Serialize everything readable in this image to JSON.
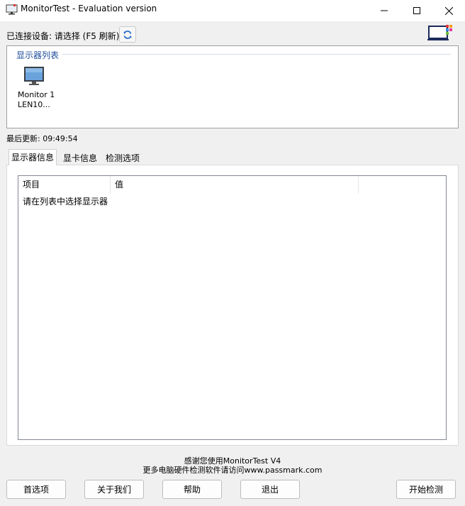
{
  "window": {
    "title": "MonitorTest - Evaluation version",
    "controls": [
      "minimize",
      "maximize",
      "close"
    ]
  },
  "device": {
    "label": "已连接设备: 请选择 (F5 刷新)",
    "refresh_icon": "refresh-icon"
  },
  "monitor_list": {
    "title": "显示器列表",
    "items": [
      {
        "name": "Monitor 1",
        "sub": "LEN10...",
        "icon": "monitor-icon"
      }
    ]
  },
  "last_update": "最后更新: 09:49:54",
  "tabs": [
    {
      "label": "显示器信息",
      "active": true
    },
    {
      "label": "显卡信息",
      "active": false
    },
    {
      "label": "检测选项",
      "active": false
    }
  ],
  "table": {
    "columns": [
      "项目",
      "值"
    ],
    "rows": [
      [
        "请在列表中选择显示器",
        ""
      ]
    ]
  },
  "footer": {
    "line1": "感谢您使用MonitorTest V4",
    "line2": "更多电脑硬件检测软件请访问www.passmark.com"
  },
  "buttons": {
    "preferences": "首选项",
    "about": "关于我们",
    "help": "帮助",
    "exit": "退出",
    "start": "开始检测"
  },
  "colors": {
    "group_title": "#1f4e9a",
    "window_bg": "#f0f0f0",
    "panel_bg": "#ffffff"
  }
}
